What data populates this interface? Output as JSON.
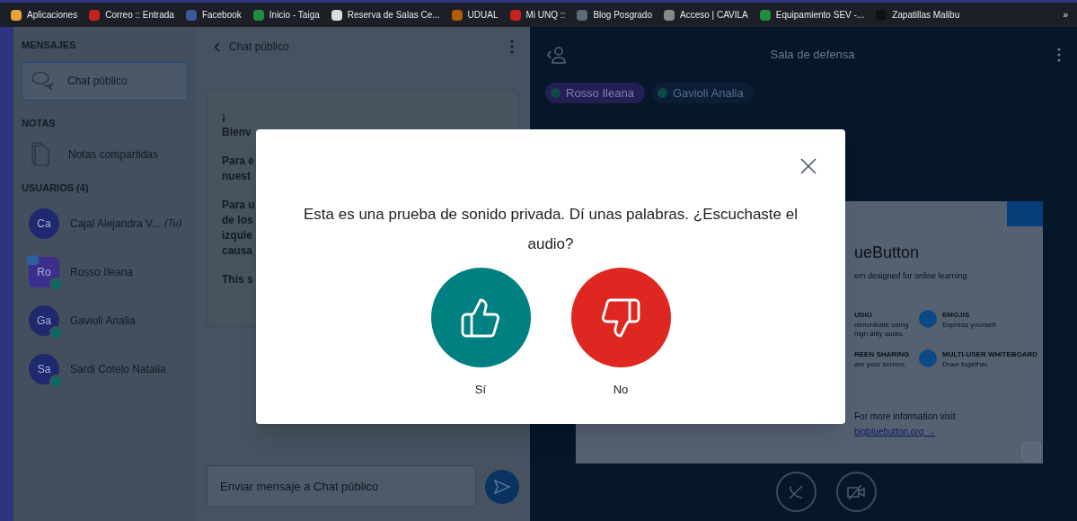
{
  "bookmarks": {
    "items": [
      {
        "label": "Aplicaciones"
      },
      {
        "label": "Correo :: Entrada"
      },
      {
        "label": "Facebook"
      },
      {
        "label": "Inicio - Taiga"
      },
      {
        "label": "Reserva de Salas Ce..."
      },
      {
        "label": "UDUAL"
      },
      {
        "label": "Mi UNQ ::"
      },
      {
        "label": "Blog Posgrado"
      },
      {
        "label": "Acceso | CAVILA"
      },
      {
        "label": "Equipamiento SEV -..."
      },
      {
        "label": "Zapatillas Malibu"
      }
    ],
    "overflow": "»"
  },
  "sidebar": {
    "messages": {
      "title": "MENSAJES",
      "items": [
        {
          "label": "Chat público",
          "selected": true
        }
      ]
    },
    "notes": {
      "title": "NOTAS",
      "items": [
        {
          "label": "Notas compartidas"
        }
      ]
    },
    "users": {
      "title": "USUARIOS (4)",
      "items": [
        {
          "initials": "Ca",
          "name": "Cajal Alejandra V...",
          "you_label": "(Tu)",
          "color": "#1f2a6e",
          "presenter": false,
          "mic": false
        },
        {
          "initials": "Ro",
          "name": "Rosso Ileana",
          "color": "#3c2f8c",
          "presenter": true,
          "mic": true
        },
        {
          "initials": "Ga",
          "name": "Gavioli Analia",
          "color": "#1f2a6e",
          "presenter": false,
          "mic": true
        },
        {
          "initials": "Sa",
          "name": "Sardi Cotelo Natalia",
          "color": "#1f2a6e",
          "presenter": false,
          "mic": true
        }
      ]
    }
  },
  "chat": {
    "title": "Chat público",
    "paragraphs": [
      [
        "¡",
        "Bienv"
      ],
      [
        "Para e",
        "nuest"
      ],
      [
        "Para u",
        "de los",
        "izquie",
        "causa"
      ],
      [
        "This s"
      ]
    ],
    "input": {
      "placeholder": "Enviar mensaje a Chat público"
    }
  },
  "main": {
    "title": "Sala de defensa",
    "talkers": [
      {
        "name": "Rosso Ileana",
        "talking": true
      },
      {
        "name": "Gavioli Analia",
        "talking": false
      }
    ],
    "slide": {
      "heading": "ueButton",
      "subtitle": "em designed for online learning",
      "features": [
        {
          "title": "UDIO",
          "text": "mmunicate using high ality audio."
        },
        {
          "title": "EMOJIS",
          "text": "Express yourself."
        },
        {
          "title": "REEN SHARING",
          "text": "are your screen."
        },
        {
          "title": "MULTI-USER WHITEBOARD",
          "text": "Draw together."
        }
      ],
      "footer": "For more information visit",
      "link": "bigbluebutton.org →"
    }
  },
  "modal": {
    "message": "Esta es una prueba de sonido privada. Dí unas palabras. ¿Escuchaste el audio?",
    "answers": [
      {
        "kind": "yes",
        "label": "Sí"
      },
      {
        "kind": "no",
        "label": "No"
      }
    ]
  }
}
